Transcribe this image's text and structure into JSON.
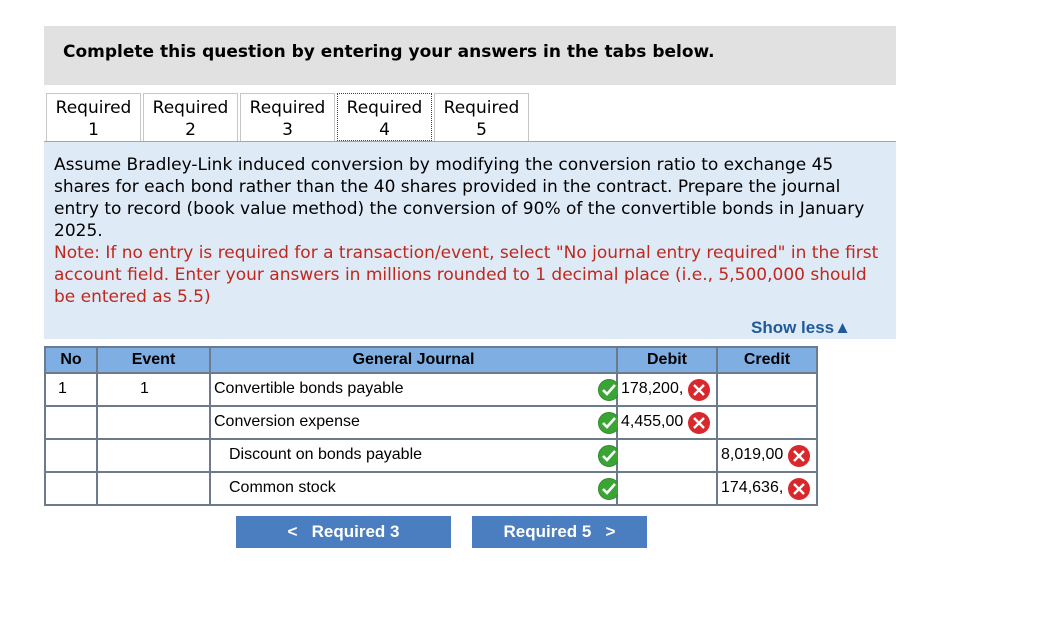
{
  "header": {
    "question": "Complete this question by entering your answers in the tabs below."
  },
  "tabs": [
    {
      "line1": "Required",
      "line2": "1"
    },
    {
      "line1": "Required",
      "line2": "2"
    },
    {
      "line1": "Required",
      "line2": "3"
    },
    {
      "line1": "Required",
      "line2": "4"
    },
    {
      "line1": "Required",
      "line2": "5"
    }
  ],
  "instructions": {
    "body": "Assume Bradley-Link induced conversion by modifying the conversion ratio to exchange 45 shares for each bond rather than the 40 shares provided in the contract. Prepare the journal entry to record (book value method) the conversion of 90% of the convertible bonds in January 2025.",
    "note": "Note: If no entry is required for a transaction/event, select \"No journal entry required\" in the first account field. Enter your answers in millions rounded to 1 decimal place (i.e., 5,500,000 should be entered as 5.5)"
  },
  "show_less": "Show less▲",
  "table": {
    "headers": {
      "no": "No",
      "event": "Event",
      "journal": "General Journal",
      "debit": "Debit",
      "credit": "Credit"
    },
    "rows": [
      {
        "no": "1",
        "event": "1",
        "account": "Convertible bonds payable",
        "debit": "178,200,",
        "credit": ""
      },
      {
        "no": "",
        "event": "",
        "account": "Conversion expense",
        "debit": "4,455,00",
        "credit": ""
      },
      {
        "no": "",
        "event": "",
        "account": "Discount on bonds payable",
        "debit": "",
        "credit": "8,019,00"
      },
      {
        "no": "",
        "event": "",
        "account": "Common stock",
        "debit": "",
        "credit": "174,636,"
      }
    ]
  },
  "nav": {
    "prev_label": "Required 3",
    "next_label": "Required 5",
    "prev_glyph": "<",
    "next_glyph": ">"
  },
  "colors": {
    "check": "#3aa535",
    "error": "#d8282c",
    "header_blue": "#7faee3",
    "button": "#4a7ec0"
  }
}
